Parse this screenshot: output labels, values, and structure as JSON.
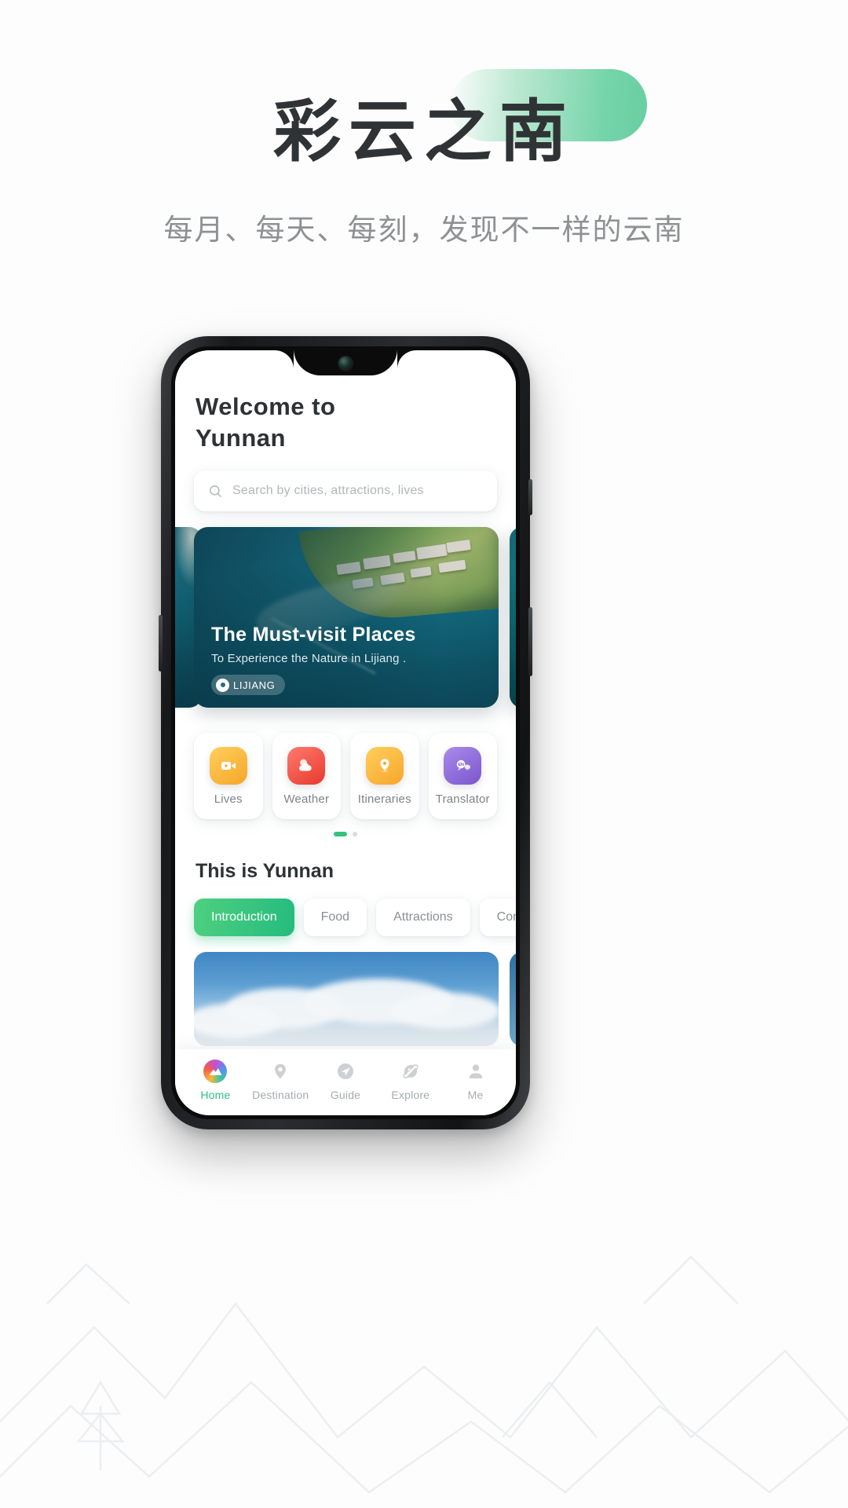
{
  "poster": {
    "title": "彩云之南",
    "subtitle": "每月、每天、每刻，发现不一样的云南",
    "accent_green": "#35c37a",
    "pill_green": "#68cea0"
  },
  "phone": {
    "app": {
      "welcome_line1": "Welcome  to",
      "welcome_line2": "Yunnan",
      "search": {
        "placeholder": "Search by cities, attractions, lives",
        "icon": "search-icon"
      },
      "hero": {
        "title": "The Must-visit Places",
        "subtitle": "To Experience the Nature in Lijiang .",
        "badge": "LIJIANG",
        "badge_icon": "location-pin-icon"
      },
      "quick_actions": [
        {
          "label": "Lives",
          "icon": "video-camera-icon",
          "color": "#f7b733"
        },
        {
          "label": "Weather",
          "icon": "cloud-icon",
          "color": "#ef4b4b"
        },
        {
          "label": "Itineraries",
          "icon": "map-pin-icon",
          "color": "#f7b733"
        },
        {
          "label": "Translator",
          "icon": "translate-icon",
          "color": "#8b68d6",
          "badge": "EN"
        }
      ],
      "pager": {
        "active_index": 0,
        "count": 2
      },
      "section_title": "This is Yunnan",
      "tabs": [
        {
          "label": "Introduction",
          "active": true
        },
        {
          "label": "Food",
          "active": false
        },
        {
          "label": "Attractions",
          "active": false
        },
        {
          "label": "Complaints",
          "active": false
        }
      ],
      "bottom_nav": [
        {
          "label": "Home",
          "icon": "home-logo-icon",
          "active": true
        },
        {
          "label": "Destination",
          "icon": "location-pin-icon",
          "active": false
        },
        {
          "label": "Guide",
          "icon": "paper-plane-icon",
          "active": false
        },
        {
          "label": "Explore",
          "icon": "planet-icon",
          "active": false
        },
        {
          "label": "Me",
          "icon": "person-icon",
          "active": false
        }
      ]
    }
  }
}
